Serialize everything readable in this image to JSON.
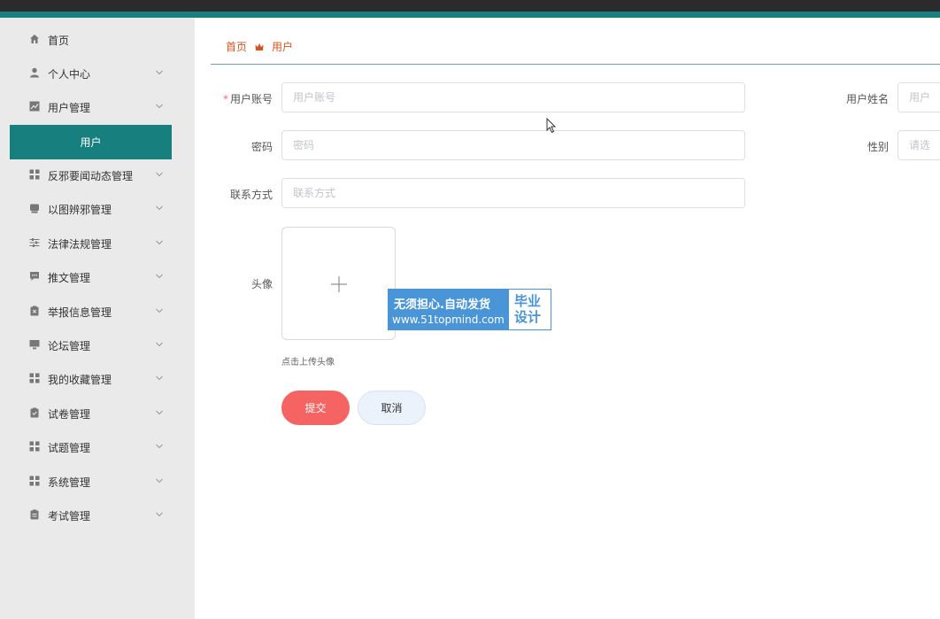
{
  "sidebar": {
    "items": [
      {
        "label": "首页",
        "icon": "home-icon",
        "has_chevron": false
      },
      {
        "label": "个人中心",
        "icon": "user-icon",
        "has_chevron": true
      },
      {
        "label": "用户管理",
        "icon": "chart-icon",
        "has_chevron": true
      },
      {
        "label": "反邪要闻动态管理",
        "icon": "grid-icon",
        "has_chevron": true
      },
      {
        "label": "以图辨邪管理",
        "icon": "image-icon",
        "has_chevron": true
      },
      {
        "label": "法律法规管理",
        "icon": "sliders-icon",
        "has_chevron": true
      },
      {
        "label": "推文管理",
        "icon": "comment-icon",
        "has_chevron": true
      },
      {
        "label": "举报信息管理",
        "icon": "clipboard-x-icon",
        "has_chevron": true
      },
      {
        "label": "论坛管理",
        "icon": "monitor-icon",
        "has_chevron": true
      },
      {
        "label": "我的收藏管理",
        "icon": "grid-icon",
        "has_chevron": true
      },
      {
        "label": "试卷管理",
        "icon": "clipboard-check-icon",
        "has_chevron": true
      },
      {
        "label": "试题管理",
        "icon": "grid-icon",
        "has_chevron": true
      },
      {
        "label": "系统管理",
        "icon": "grid-icon",
        "has_chevron": true
      },
      {
        "label": "考试管理",
        "icon": "clipboard-icon",
        "has_chevron": true
      }
    ],
    "active_submenu": "用户"
  },
  "breadcrumb": {
    "home": "首页",
    "separator_icon": "crown-icon",
    "current": "用户"
  },
  "form": {
    "account": {
      "label": "用户账号",
      "placeholder": "用户账号",
      "required": true
    },
    "name": {
      "label": "用户姓名",
      "placeholder": "用户姓名"
    },
    "password": {
      "label": "密码",
      "placeholder": "密码"
    },
    "gender": {
      "label": "性别",
      "placeholder": "请选择性别"
    },
    "contact": {
      "label": "联系方式",
      "placeholder": "联系方式"
    },
    "avatar": {
      "label": "头像",
      "tip": "点击上传头像"
    },
    "submit_label": "提交",
    "cancel_label": "取消",
    "required_mark": "*"
  },
  "watermark": {
    "line1": "无须担心.自动发货",
    "line2": "www.51topmind.com",
    "right_line1": "毕业",
    "right_line2": "设计"
  },
  "colors": {
    "primary": "#17807e",
    "accent": "#d9531e",
    "submit": "#f56462",
    "watermark": "#4a94d8"
  }
}
